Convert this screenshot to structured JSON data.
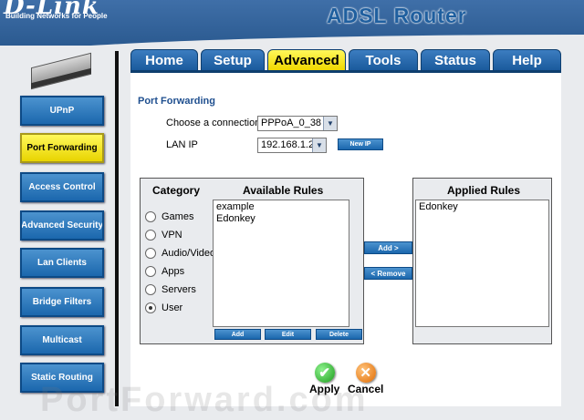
{
  "brand": {
    "logo_text": "D-Link",
    "tagline": "Building Networks for People",
    "product_title": "ADSL Router"
  },
  "sidebar": {
    "items": [
      {
        "label": "UPnP"
      },
      {
        "label": "Port Forwarding"
      },
      {
        "label": "Access Control"
      },
      {
        "label": "Advanced Security"
      },
      {
        "label": "Lan Clients"
      },
      {
        "label": "Bridge Filters"
      },
      {
        "label": "Multicast"
      },
      {
        "label": "Static Routing"
      }
    ],
    "active_item": "Port Forwarding"
  },
  "tabs": [
    {
      "label": "Home"
    },
    {
      "label": "Setup"
    },
    {
      "label": "Advanced"
    },
    {
      "label": "Tools"
    },
    {
      "label": "Status"
    },
    {
      "label": "Help"
    }
  ],
  "active_tab": "Advanced",
  "content": {
    "section_title": "Port Forwarding",
    "connection_label": "Choose a connection",
    "connection_value": "PPPoA_0_38",
    "lan_ip_label": "LAN IP",
    "lan_ip_value": "192.168.1.2",
    "new_ip_button": "New IP",
    "category_heading": "Category",
    "categories": [
      {
        "label": "Games",
        "selected": false
      },
      {
        "label": "VPN",
        "selected": false
      },
      {
        "label": "Audio/Video",
        "selected": false
      },
      {
        "label": "Apps",
        "selected": false
      },
      {
        "label": "Servers",
        "selected": false
      },
      {
        "label": "User",
        "selected": true
      }
    ],
    "available_heading": "Available Rules",
    "available_rules": [
      "example",
      "Edonkey"
    ],
    "rule_buttons": {
      "add": "Add",
      "edit": "Edit",
      "delete": "Delete"
    },
    "add_arrow_button": "Add >",
    "remove_arrow_button": "< Remove",
    "applied_heading": "Applied Rules",
    "applied_rules": [
      "Edonkey"
    ],
    "apply_label": "Apply",
    "cancel_label": "Cancel",
    "watermark": "PortForward.com"
  },
  "colors": {
    "accent_blue": "#1b67ad",
    "active_yellow": "#f0d800",
    "header_blue": "#2b5a90"
  }
}
